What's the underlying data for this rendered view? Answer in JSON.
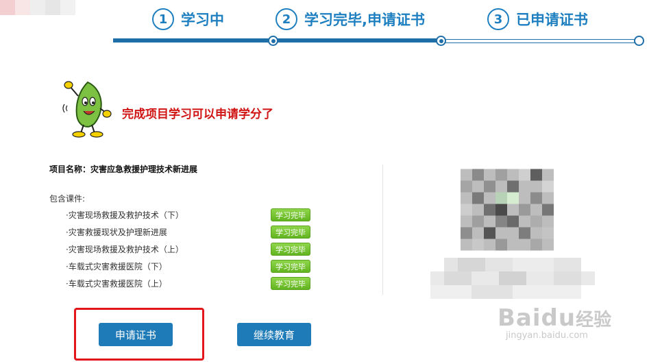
{
  "steps": [
    {
      "number": "1",
      "label": "学习中"
    },
    {
      "number": "2",
      "label": "学习完毕,申请证书"
    },
    {
      "number": "3",
      "label": "已申请证书"
    }
  ],
  "headline": "完成项目学习可以申请学分了",
  "project": {
    "label": "项目名称：",
    "name": "灾害应急救援护理技术新进展"
  },
  "courses_title": "包含课件:",
  "courses": [
    {
      "name": "·灾害现场救援及救护技术（下）",
      "status": "学习完毕"
    },
    {
      "name": "·灾害救援现状及护理新进展",
      "status": "学习完毕"
    },
    {
      "name": "·灾害现场救援及救护技术（上）",
      "status": "学习完毕"
    },
    {
      "name": "·车载式灾害救援医院（下）",
      "status": "学习完毕"
    },
    {
      "name": "·车载式灾害救援医院（上）",
      "status": "学习完毕"
    }
  ],
  "buttons": {
    "apply_certificate": "申请证书",
    "continue_education": "继续教育"
  },
  "watermark": {
    "brand": "Baidu",
    "brand_cn": "经验",
    "url": "jingyan.baidu.com"
  },
  "colors": {
    "accent": "#1e7fc0",
    "headline": "#d01414",
    "badge": "#6cbf2a",
    "highlight": "#e3161c"
  }
}
